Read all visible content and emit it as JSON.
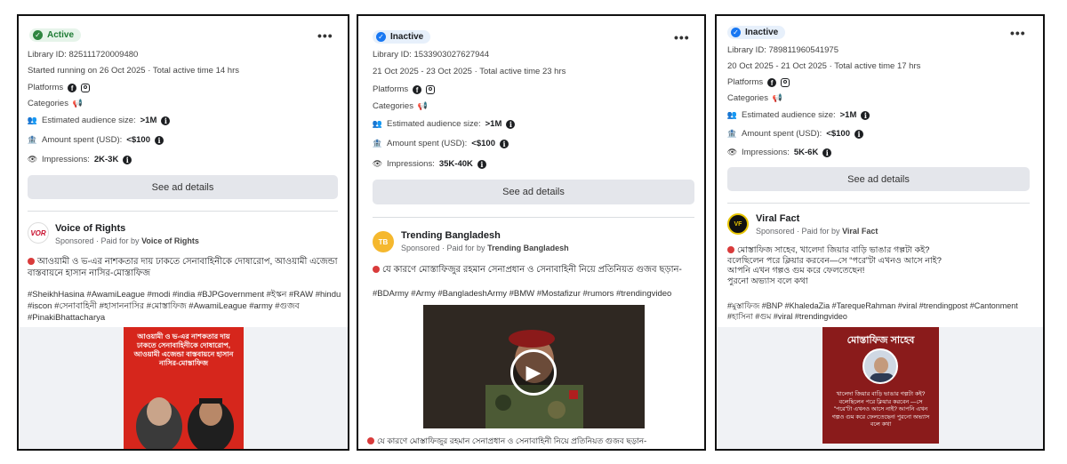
{
  "cards": [
    {
      "status": "Active",
      "status_icon": "check-circle-icon",
      "more": "•••",
      "library_id": "Library ID: 825111720009480",
      "run_info": "Started running on 26 Oct 2025 · Total active time 14 hrs",
      "platforms_label": "Platforms",
      "categories_label": "Categories",
      "audience_label": "Estimated audience size:",
      "audience_value": ">1M",
      "spent_label": "Amount spent (USD):",
      "spent_value": "<$100",
      "impressions_label": "Impressions:",
      "impressions_value": "2K-3K",
      "see_details": "See ad details",
      "page_name": "Voice of Rights",
      "avatar_text": "VOR",
      "sponsored": "Sponsored · Paid for by",
      "paid_by": "Voice of Rights",
      "body": "আওয়ামী ও ভ-এর নাশকতার দায় ঢাকতে সেনাবাহিনীকে দোষারোপ, আওয়ামী এজেন্ডা বাস্তবায়নে হাসান নাসির-মোস্তাফিজ",
      "hashtags": "#SheikhHasina #AwamiLeague #modi #india #BJPGovernment #ইস্কন #RAW #hindu #iscon #সেনাবাহিনী #হাসাননাসির #মোস্তাফিজ #AwamiLeague #army #গুজব #PinakiBhattacharya",
      "poster_text": "আওয়ামী ও ভ-এর নাশকতার দায় ঢাকতে সেনাবাহিনীকে দোষারোপ, আওয়ামী এজেন্ডা বাস্তবায়নে হাসান নাসির-মোস্তাফিজ"
    },
    {
      "status": "Inactive",
      "status_icon": "info-circle-icon",
      "more": "•••",
      "library_id": "Library ID: 1533903027627944",
      "run_info": "21 Oct 2025 - 23 Oct 2025 · Total active time 23 hrs",
      "platforms_label": "Platforms",
      "categories_label": "Categories",
      "audience_label": "Estimated audience size:",
      "audience_value": ">1M",
      "spent_label": "Amount spent (USD):",
      "spent_value": "<$100",
      "impressions_label": "Impressions:",
      "impressions_value": "35K-40K",
      "see_details": "See ad details",
      "page_name": "Trending Bangladesh",
      "avatar_text": "TB",
      "sponsored": "Sponsored · Paid for by",
      "paid_by": "Trending Bangladesh",
      "body": "যে কারণে মোস্তাফিজুর রহমান সেনাপ্রধান ও সেনাবাহিনী নিয়ে প্রতিনিয়ত গুজব ছড়ান-",
      "hashtags": "#BDArmy #Army #BangladeshArmy #BMW #Mostafizur #rumors #trendingvideo",
      "caption": "যে কারণে মোস্তাফিজুর রহমান সেনাপ্রধান ও সেনাবাহিনী নিয়ে প্রতিনিয়ত গুজব ছড়ান-"
    },
    {
      "status": "Inactive",
      "status_icon": "info-circle-icon",
      "more": "•••",
      "library_id": "Library ID: 789811960541975",
      "run_info": "20 Oct 2025 - 21 Oct 2025 · Total active time 17 hrs",
      "platforms_label": "Platforms",
      "categories_label": "Categories",
      "audience_label": "Estimated audience size:",
      "audience_value": ">1M",
      "spent_label": "Amount spent (USD):",
      "spent_value": "<$100",
      "impressions_label": "Impressions:",
      "impressions_value": "5K-6K",
      "see_details": "See ad details",
      "page_name": "Viral Fact",
      "avatar_text": "VF",
      "sponsored": "Sponsored · Paid for by",
      "paid_by": "Viral Fact",
      "body_line1": "মোস্তাফিজ সাহেব, খালেদা জিয়ার বাড়ি ভাঙার গল্পটা কই?",
      "body_line2": "বলেছিলেন পরে ক্লিয়ার করবেন—সে “পরে”টা এখনও আসে নাই?",
      "body_line3": "আপনি এখন গল্পও গুম করে ফেলতেছেন!",
      "body_line4": "পুরনো অভ্যাস বলে কথা",
      "hashtags": "#মুস্তাফিজ #BNP #KhaledaZia #TarequeRahman #viral #trendingpost #Cantonment #হাসিনা #গুম #viral #trendingvideo",
      "poster_title": "মোস্তাফিজ সাহেব",
      "poster_text": "খালেদা জিয়ার বাড়ি ভাঙার গল্পটা কই? বলেছিলেন পরে ক্লিয়ার করবেন —সে \"পরে\"টা এখনও আসে নাই? আপনি এখন গল্পও গুম করে ফেলতেছেন! পুরনো অভ্যাস বলে কথা"
    }
  ],
  "colors": {
    "active_green": "#2e8540",
    "inactive_blue": "#1877f2",
    "button_grey": "#e4e6eb",
    "poster_red": "#d6261c",
    "poster_maroon": "#8a1b1b"
  }
}
